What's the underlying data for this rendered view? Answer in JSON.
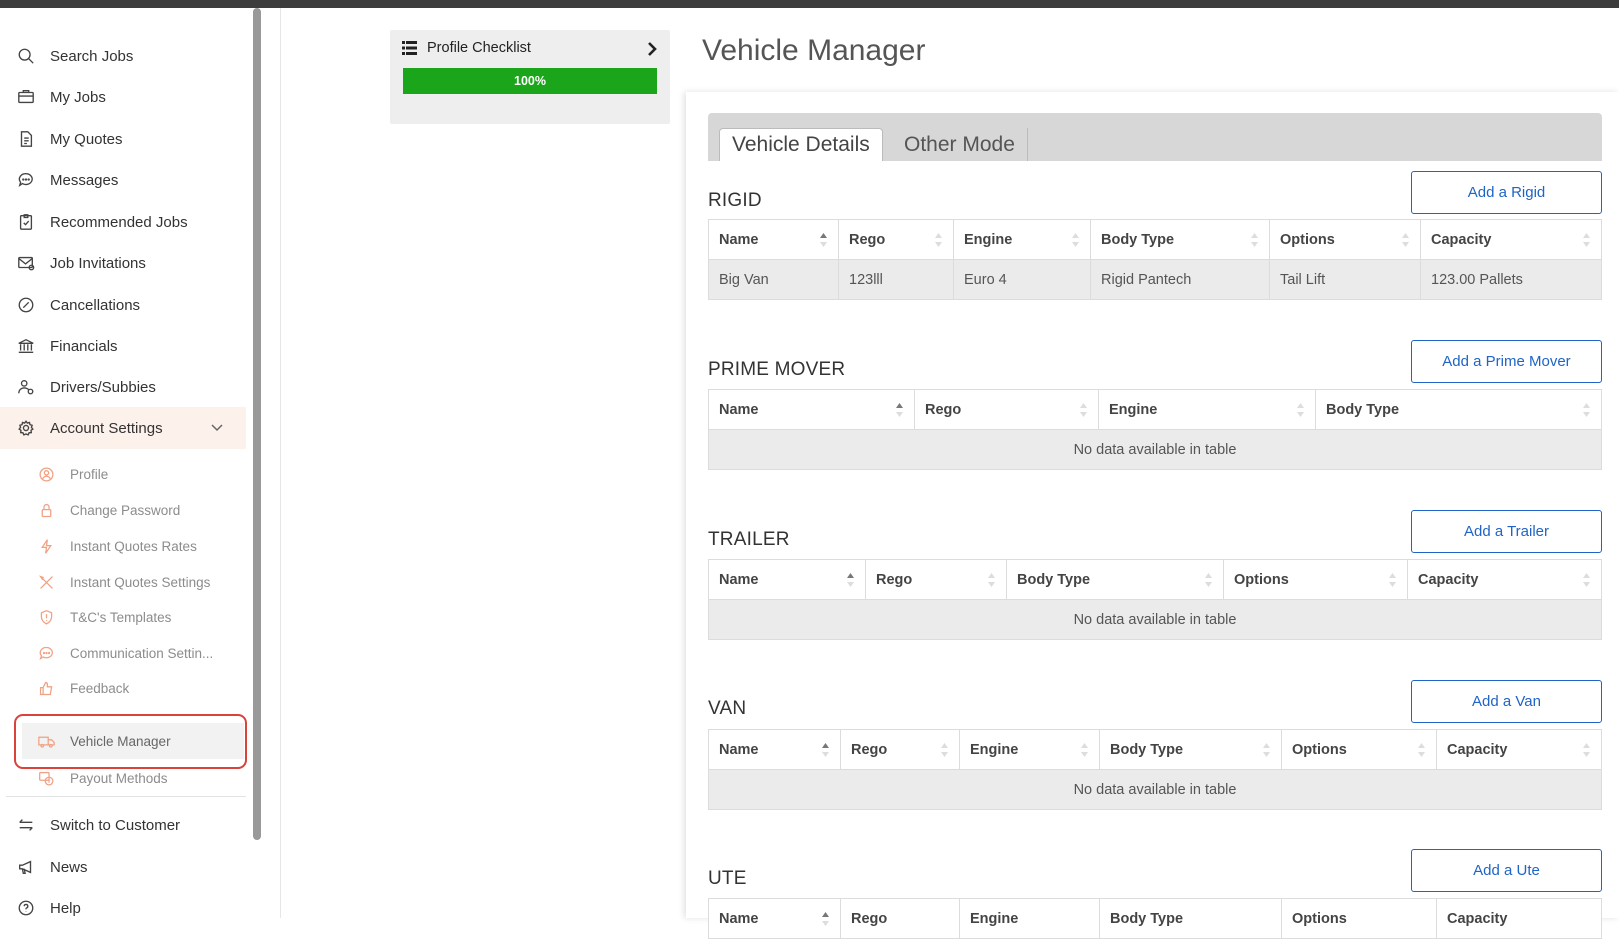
{
  "sidebar": {
    "items": [
      {
        "label": "Search Jobs",
        "icon": "search-icon"
      },
      {
        "label": "My Jobs",
        "icon": "briefcase-icon"
      },
      {
        "label": "My Quotes",
        "icon": "document-icon"
      },
      {
        "label": "Messages",
        "icon": "chat-icon"
      },
      {
        "label": "Recommended Jobs",
        "icon": "clipboard-check-icon"
      },
      {
        "label": "Job Invitations",
        "icon": "envelope-icon"
      },
      {
        "label": "Cancellations",
        "icon": "cancel-circle-icon"
      },
      {
        "label": "Financials",
        "icon": "bank-icon"
      },
      {
        "label": "Drivers/Subbies",
        "icon": "users-icon"
      },
      {
        "label": "Account Settings",
        "icon": "gear-icon"
      }
    ],
    "sub_items": [
      {
        "label": "Profile",
        "icon": "user-circle-icon"
      },
      {
        "label": "Change Password",
        "icon": "lock-icon"
      },
      {
        "label": "Instant Quotes Rates",
        "icon": "lightning-icon"
      },
      {
        "label": "Instant Quotes Settings",
        "icon": "tools-icon"
      },
      {
        "label": "T&C's Templates",
        "icon": "shield-icon"
      },
      {
        "label": "Communication Settin...",
        "icon": "chat-bubble-icon"
      },
      {
        "label": "Feedback",
        "icon": "thumbs-up-icon"
      },
      {
        "label": "Vehicle Manager",
        "icon": "truck-icon"
      },
      {
        "label": "Payout Methods",
        "icon": "payout-icon"
      }
    ],
    "bottom_items": [
      {
        "label": "Switch to Customer",
        "icon": "swap-icon"
      },
      {
        "label": "News",
        "icon": "megaphone-icon"
      },
      {
        "label": "Help",
        "icon": "help-circle-icon"
      }
    ]
  },
  "checklist": {
    "title": "Profile Checklist",
    "progress_label": "100%",
    "progress": 1.0
  },
  "page_title": "Vehicle Manager",
  "tabs": [
    {
      "label": "Vehicle Details",
      "active": true
    },
    {
      "label": "Other Mode",
      "active": false
    }
  ],
  "sections": {
    "rigid": {
      "title": "RIGID",
      "button": "Add a Rigid",
      "columns": [
        "Name",
        "Rego",
        "Engine",
        "Body Type",
        "Options",
        "Capacity"
      ],
      "rows": [
        [
          "Big Van",
          "123lll",
          "Euro 4",
          "Rigid Pantech",
          "Tail Lift",
          "123.00 Pallets"
        ]
      ]
    },
    "prime_mover": {
      "title": "PRIME MOVER",
      "button": "Add a Prime Mover",
      "columns": [
        "Name",
        "Rego",
        "Engine",
        "Body Type"
      ],
      "empty": "No data available in table"
    },
    "trailer": {
      "title": "TRAILER",
      "button": "Add a Trailer",
      "columns": [
        "Name",
        "Rego",
        "Body Type",
        "Options",
        "Capacity"
      ],
      "empty": "No data available in table"
    },
    "van": {
      "title": "VAN",
      "button": "Add a Van",
      "columns": [
        "Name",
        "Rego",
        "Engine",
        "Body Type",
        "Options",
        "Capacity"
      ],
      "empty": "No data available in table"
    },
    "ute": {
      "title": "UTE",
      "button": "Add a Ute",
      "columns": [
        "Name",
        "Rego",
        "Engine",
        "Body Type",
        "Options",
        "Capacity"
      ]
    }
  },
  "colors": {
    "accent": "#1f64c6",
    "progress": "#1aa51a",
    "highlight": "#d9433a",
    "submenu_icon": "#f0a285"
  }
}
